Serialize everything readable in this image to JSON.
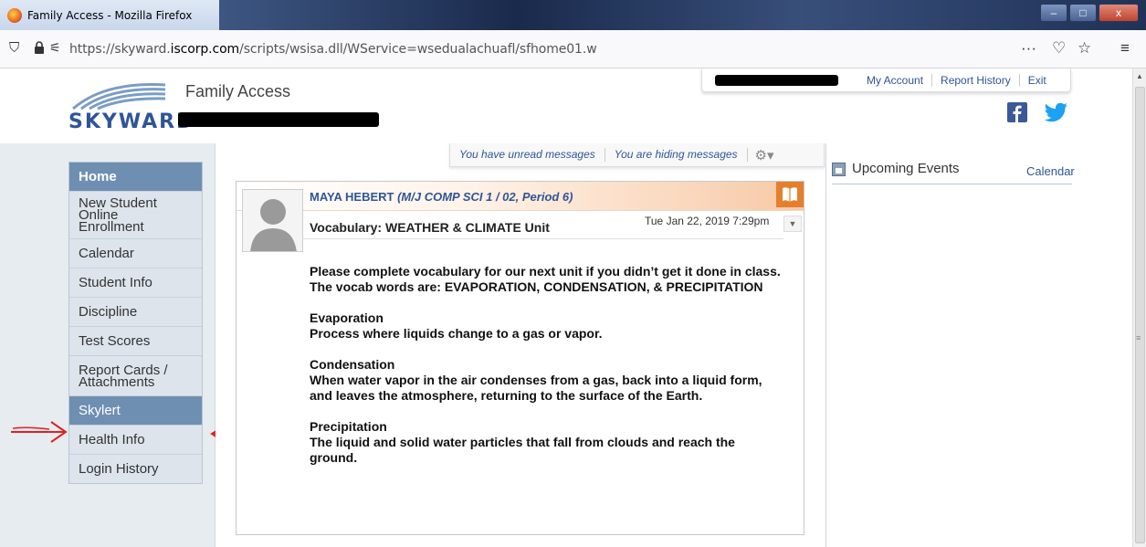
{
  "window": {
    "title": "Family Access - Mozilla Firefox",
    "controls": {
      "minimize": "–",
      "maximize": "□",
      "close": "x"
    }
  },
  "urlbar": {
    "url_prefix": "https://skyward.",
    "url_domain": "iscorp.com",
    "url_path": "/scripts/wsisa.dll/WService=wsedualachuafl/sfhome01.w",
    "icons": [
      "shield-icon",
      "lock-icon",
      "permissions-icon",
      "more-icon",
      "pocket-icon",
      "star-icon",
      "menu-icon"
    ],
    "more": "···",
    "pocket": "♡",
    "star": "☆",
    "menu": "≡"
  },
  "header": {
    "brand": "SKYWARD",
    "product": "Family Access",
    "links": [
      "My Account",
      "Report History",
      "Exit"
    ],
    "social": [
      "facebook-icon",
      "twitter-icon"
    ]
  },
  "nav": {
    "items": [
      {
        "label": "Home"
      },
      {
        "label": "New Student Online Enrollment"
      },
      {
        "label": "Calendar"
      },
      {
        "label": "Student Info"
      },
      {
        "label": "Discipline"
      },
      {
        "label": "Test Scores"
      },
      {
        "label": "Report Cards / Attachments"
      },
      {
        "label": "Skylert"
      },
      {
        "label": "Health Info"
      },
      {
        "label": "Login History"
      }
    ],
    "active": "Skylert"
  },
  "messages_bar": {
    "unread": "You have unread messages",
    "hiding": "You are hiding messages"
  },
  "message": {
    "sender": "MAYA HEBERT",
    "course": "(M/J COMP SCI 1 / 02, Period 6)",
    "subject": "Vocabulary: WEATHER & CLIMATE Unit",
    "date": "Tue Jan 22, 2019 7:29pm",
    "body": {
      "p1": "Please complete vocabulary for our next unit if you didn’t get it done in class.",
      "p2": "The vocab words are: EVAPORATION,  CONDENSATION, & PRECIPITATION",
      "t1": "Evaporation",
      "d1": "Process where liquids change to a gas or vapor.",
      "t2": "Condensation",
      "d2": "When water vapor in the air condenses from a gas, back into a liquid form, and leaves the atmosphere, returning to the surface of the Earth.",
      "t3": "Precipitation",
      "d3": "The liquid and solid water particles that fall from clouds and reach the ground."
    }
  },
  "events": {
    "title": "Upcoming Events",
    "calendar_link": "Calendar"
  },
  "colors": {
    "nav_active": "#6f8fb2",
    "link": "#2f5597",
    "annotation_arrow": "#e02020",
    "message_accent": "#e57f2d"
  }
}
